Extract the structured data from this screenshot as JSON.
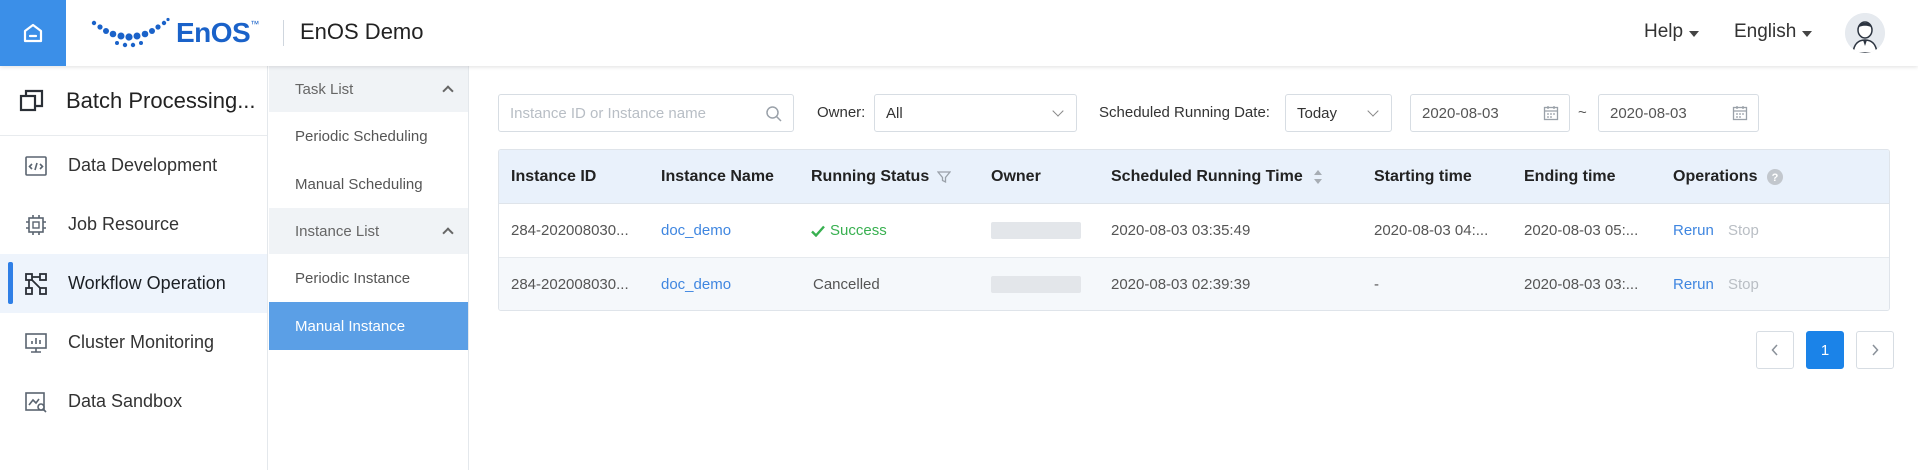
{
  "header": {
    "logo_text": "EnOS",
    "logo_tm": "™",
    "app_title": "EnOS Demo",
    "help_label": "Help",
    "language_label": "English",
    "accent_color": "#3b8fe8"
  },
  "sidebar": {
    "title": "Batch Processing...",
    "items": [
      {
        "label": "Data Development",
        "icon": "code-window-icon"
      },
      {
        "label": "Job Resource",
        "icon": "chip-icon"
      },
      {
        "label": "Workflow Operation",
        "icon": "workflow-icon",
        "active": true
      },
      {
        "label": "Cluster Monitoring",
        "icon": "monitor-chart-icon"
      },
      {
        "label": "Data Sandbox",
        "icon": "sandbox-search-icon"
      }
    ]
  },
  "subsidebar": {
    "groups": [
      {
        "label": "Task List",
        "items": [
          "Periodic Scheduling",
          "Manual Scheduling"
        ]
      },
      {
        "label": "Instance List",
        "items": [
          "Periodic Instance",
          "Manual Instance"
        ]
      }
    ],
    "active_item": "Manual Instance"
  },
  "filters": {
    "search_placeholder": "Instance ID or Instance name",
    "owner_label": "Owner:",
    "owner_value": "All",
    "scheduled_label": "Scheduled Running Date:",
    "scheduled_value": "Today",
    "date_from": "2020-08-03",
    "date_separator": "~",
    "date_to": "2020-08-03"
  },
  "table": {
    "columns": [
      "Instance ID",
      "Instance Name",
      "Running Status",
      "Owner",
      "Scheduled Running Time",
      "Starting time",
      "Ending time",
      "Operations"
    ],
    "rows": [
      {
        "instance_id": "284-202008030...",
        "instance_name": "doc_demo",
        "status": "Success",
        "scheduled_time": "2020-08-03 03:35:49",
        "starting_time": "2020-08-03 04:...",
        "ending_time": "2020-08-03 05:...",
        "op_rerun": "Rerun",
        "op_stop": "Stop"
      },
      {
        "instance_id": "284-202008030...",
        "instance_name": "doc_demo",
        "status": "Cancelled",
        "scheduled_time": "2020-08-03 02:39:39",
        "starting_time": "-",
        "ending_time": "2020-08-03 03:...",
        "op_rerun": "Rerun",
        "op_stop": "Stop"
      }
    ]
  },
  "pagination": {
    "current_page": "1"
  }
}
